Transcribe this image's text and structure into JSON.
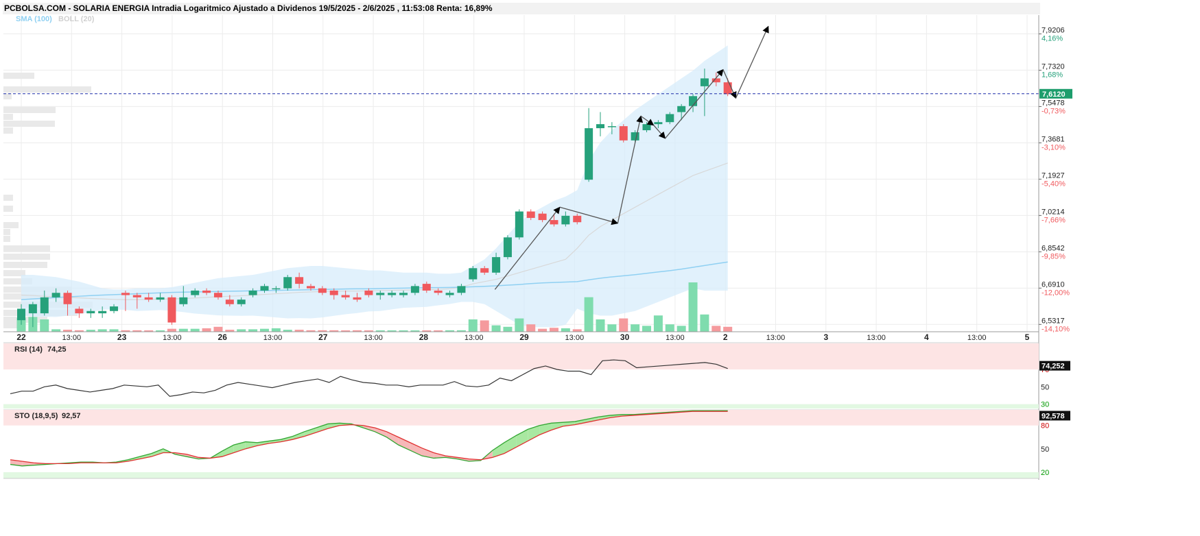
{
  "title": "PCBOLSA.COM - SOLARIA ENERGIA Intradia Logaritmico Ajustado a Dividenos 19/5/2025 - 2/6/2025 , 11:53:08 Renta: 16,89%",
  "indicators_label": {
    "sma": "SMA (100)",
    "boll": "BOLL (20)"
  },
  "colors": {
    "up": "#26a17b",
    "down": "#f0595d",
    "band": "#d7ecfb",
    "sma": "#8fd0f2",
    "mid": "#d8d8d8",
    "last_price": "#1d9d6c",
    "dashed": "#1a2aa8"
  },
  "last_price_label": "7,6120",
  "x_axis": {
    "ticks": [
      "22",
      "13:00",
      "23",
      "13:00",
      "26",
      "13:00",
      "27",
      "13:00",
      "28",
      "13:00",
      "29",
      "13:00",
      "30",
      "13:00",
      "2",
      "13:00",
      "3",
      "13:00",
      "4",
      "13:00",
      "5"
    ]
  },
  "y_axis": {
    "ticks": [
      {
        "price": "7,9206",
        "pct": "4,16%",
        "pct_color": "up"
      },
      {
        "price": "7,7320",
        "pct": "1,68%",
        "pct_color": "up"
      },
      {
        "price": "7,5478",
        "pct": "-0,73%",
        "pct_color": "down"
      },
      {
        "price": "7,3681",
        "pct": "-3,10%",
        "pct_color": "down"
      },
      {
        "price": "7,1927",
        "pct": "-5,40%",
        "pct_color": "down"
      },
      {
        "price": "7,0214",
        "pct": "-7,66%",
        "pct_color": "down"
      },
      {
        "price": "6,8542",
        "pct": "-9,85%",
        "pct_color": "down"
      },
      {
        "price": "6,6910",
        "pct": "-12,00%",
        "pct_color": "down"
      },
      {
        "price": "6,5317",
        "pct": "-14,10%",
        "pct_color": "down"
      }
    ]
  },
  "rsi": {
    "label": "RSI (14)",
    "value": "74,25",
    "badge": "74,252",
    "levels": [
      "70",
      "50",
      "30"
    ]
  },
  "sto": {
    "label": "STO (18,9,5)",
    "value": "92,57",
    "badge": "92,578",
    "levels": [
      "80",
      "50",
      "20"
    ]
  },
  "chart_data": {
    "type": "candlestick",
    "title": "PCBOLSA.COM - SOLARIA ENERGIA Intradia Logaritmico Ajustado a Dividenos 19/5/2025 - 2/6/2025 , 11:53:08 Renta: 16,89%",
    "y_scale": "log",
    "ylim": [
      6.5,
      8.02
    ],
    "last_price": 7.612,
    "candles": [
      {
        "o": 6.55,
        "h": 6.62,
        "l": 6.53,
        "c": 6.6
      },
      {
        "o": 6.58,
        "h": 6.63,
        "l": 6.52,
        "c": 6.62
      },
      {
        "o": 6.58,
        "h": 6.68,
        "l": 6.57,
        "c": 6.65
      },
      {
        "o": 6.65,
        "h": 6.69,
        "l": 6.63,
        "c": 6.67
      },
      {
        "o": 6.67,
        "h": 6.68,
        "l": 6.57,
        "c": 6.62
      },
      {
        "o": 6.6,
        "h": 6.61,
        "l": 6.56,
        "c": 6.58
      },
      {
        "o": 6.58,
        "h": 6.6,
        "l": 6.56,
        "c": 6.59
      },
      {
        "o": 6.58,
        "h": 6.61,
        "l": 6.56,
        "c": 6.59
      },
      {
        "o": 6.59,
        "h": 6.62,
        "l": 6.58,
        "c": 6.61
      },
      {
        "o": 6.67,
        "h": 6.68,
        "l": 6.59,
        "c": 6.66
      },
      {
        "o": 6.66,
        "h": 6.67,
        "l": 6.6,
        "c": 6.65
      },
      {
        "o": 6.65,
        "h": 6.67,
        "l": 6.63,
        "c": 6.64
      },
      {
        "o": 6.64,
        "h": 6.67,
        "l": 6.63,
        "c": 6.65
      },
      {
        "o": 6.65,
        "h": 6.66,
        "l": 6.53,
        "c": 6.54
      },
      {
        "o": 6.62,
        "h": 6.7,
        "l": 6.61,
        "c": 6.65
      },
      {
        "o": 6.66,
        "h": 6.69,
        "l": 6.65,
        "c": 6.68
      },
      {
        "o": 6.68,
        "h": 6.69,
        "l": 6.66,
        "c": 6.67
      },
      {
        "o": 6.67,
        "h": 6.68,
        "l": 6.64,
        "c": 6.65
      },
      {
        "o": 6.64,
        "h": 6.66,
        "l": 6.61,
        "c": 6.62
      },
      {
        "o": 6.62,
        "h": 6.65,
        "l": 6.61,
        "c": 6.64
      },
      {
        "o": 6.66,
        "h": 6.69,
        "l": 6.65,
        "c": 6.68
      },
      {
        "o": 6.68,
        "h": 6.71,
        "l": 6.67,
        "c": 6.7
      },
      {
        "o": 6.69,
        "h": 6.7,
        "l": 6.67,
        "c": 6.69
      },
      {
        "o": 6.69,
        "h": 6.75,
        "l": 6.68,
        "c": 6.74
      },
      {
        "o": 6.74,
        "h": 6.76,
        "l": 6.69,
        "c": 6.71
      },
      {
        "o": 6.7,
        "h": 6.71,
        "l": 6.68,
        "c": 6.69
      },
      {
        "o": 6.69,
        "h": 6.7,
        "l": 6.66,
        "c": 6.67
      },
      {
        "o": 6.68,
        "h": 6.69,
        "l": 6.64,
        "c": 6.66
      },
      {
        "o": 6.66,
        "h": 6.68,
        "l": 6.64,
        "c": 6.65
      },
      {
        "o": 6.65,
        "h": 6.67,
        "l": 6.63,
        "c": 6.64
      },
      {
        "o": 6.68,
        "h": 6.69,
        "l": 6.65,
        "c": 6.66
      },
      {
        "o": 6.66,
        "h": 6.68,
        "l": 6.64,
        "c": 6.67
      },
      {
        "o": 6.66,
        "h": 6.68,
        "l": 6.65,
        "c": 6.67
      },
      {
        "o": 6.66,
        "h": 6.68,
        "l": 6.65,
        "c": 6.67
      },
      {
        "o": 6.67,
        "h": 6.71,
        "l": 6.66,
        "c": 6.7
      },
      {
        "o": 6.71,
        "h": 6.72,
        "l": 6.67,
        "c": 6.68
      },
      {
        "o": 6.68,
        "h": 6.69,
        "l": 6.66,
        "c": 6.67
      },
      {
        "o": 6.66,
        "h": 6.68,
        "l": 6.65,
        "c": 6.67
      },
      {
        "o": 6.67,
        "h": 6.71,
        "l": 6.66,
        "c": 6.7
      },
      {
        "o": 6.73,
        "h": 6.79,
        "l": 6.72,
        "c": 6.78
      },
      {
        "o": 6.78,
        "h": 6.79,
        "l": 6.75,
        "c": 6.76
      },
      {
        "o": 6.76,
        "h": 6.85,
        "l": 6.75,
        "c": 6.83
      },
      {
        "o": 6.83,
        "h": 6.93,
        "l": 6.82,
        "c": 6.92
      },
      {
        "o": 6.92,
        "h": 7.05,
        "l": 6.91,
        "c": 7.04
      },
      {
        "o": 7.04,
        "h": 7.05,
        "l": 7.0,
        "c": 7.01
      },
      {
        "o": 7.03,
        "h": 7.04,
        "l": 6.99,
        "c": 7.0
      },
      {
        "o": 7.0,
        "h": 7.03,
        "l": 6.97,
        "c": 6.98
      },
      {
        "o": 6.98,
        "h": 7.04,
        "l": 6.97,
        "c": 7.02
      },
      {
        "o": 7.02,
        "h": 7.03,
        "l": 6.98,
        "c": 6.99
      },
      {
        "o": 7.19,
        "h": 7.54,
        "l": 7.18,
        "c": 7.44
      },
      {
        "o": 7.44,
        "h": 7.52,
        "l": 7.4,
        "c": 7.46
      },
      {
        "o": 7.45,
        "h": 7.47,
        "l": 7.41,
        "c": 7.45
      },
      {
        "o": 7.45,
        "h": 7.46,
        "l": 7.37,
        "c": 7.38
      },
      {
        "o": 7.38,
        "h": 7.43,
        "l": 7.37,
        "c": 7.42
      },
      {
        "o": 7.43,
        "h": 7.47,
        "l": 7.42,
        "c": 7.46
      },
      {
        "o": 7.46,
        "h": 7.48,
        "l": 7.44,
        "c": 7.47
      },
      {
        "o": 7.47,
        "h": 7.52,
        "l": 7.46,
        "c": 7.51
      },
      {
        "o": 7.52,
        "h": 7.56,
        "l": 7.48,
        "c": 7.55
      },
      {
        "o": 7.55,
        "h": 7.61,
        "l": 7.52,
        "c": 7.6
      },
      {
        "o": 7.65,
        "h": 7.74,
        "l": 7.5,
        "c": 7.69
      },
      {
        "o": 7.69,
        "h": 7.72,
        "l": 7.65,
        "c": 7.67
      },
      {
        "o": 7.67,
        "h": 7.69,
        "l": 7.6,
        "c": 7.61
      }
    ],
    "volume_relative": [
      0.28,
      0.3,
      0.25,
      0.05,
      0.04,
      0.03,
      0.04,
      0.05,
      0.05,
      0.03,
      0.03,
      0.02,
      0.02,
      0.06,
      0.06,
      0.06,
      0.07,
      0.1,
      0.04,
      0.05,
      0.05,
      0.06,
      0.07,
      0.04,
      0.04,
      0.03,
      0.03,
      0.03,
      0.02,
      0.03,
      0.02,
      0.02,
      0.02,
      0.02,
      0.02,
      0.02,
      0.02,
      0.03,
      0.03,
      0.25,
      0.23,
      0.13,
      0.1,
      0.27,
      0.15,
      0.06,
      0.08,
      0.07,
      0.05,
      0.7,
      0.25,
      0.15,
      0.27,
      0.15,
      0.12,
      0.33,
      0.15,
      0.12,
      1.0,
      0.35,
      0.12,
      0.1
    ],
    "sma100": [
      6.64,
      6.643,
      6.646,
      6.649,
      6.652,
      6.655,
      6.658,
      6.66,
      6.662,
      6.664,
      6.666,
      6.668,
      6.67,
      6.672,
      6.673,
      6.674,
      6.675,
      6.676,
      6.677,
      6.678,
      6.679,
      6.68,
      6.681,
      6.682,
      6.683,
      6.684,
      6.685,
      6.686,
      6.687,
      6.688,
      6.688,
      6.689,
      6.69,
      6.691,
      6.692,
      6.693,
      6.693,
      6.694,
      6.695,
      6.697,
      6.699,
      6.701,
      6.704,
      6.707,
      6.711,
      6.714,
      6.716,
      6.718,
      6.72,
      6.728,
      6.735,
      6.741,
      6.746,
      6.751,
      6.757,
      6.763,
      6.769,
      6.776,
      6.784,
      6.792,
      6.8,
      6.808
    ],
    "bollinger_upper": [
      6.75,
      6.75,
      6.745,
      6.74,
      6.73,
      6.72,
      6.705,
      6.69,
      6.685,
      6.685,
      6.69,
      6.69,
      6.69,
      6.695,
      6.705,
      6.715,
      6.725,
      6.735,
      6.74,
      6.745,
      6.75,
      6.76,
      6.77,
      6.78,
      6.785,
      6.79,
      6.79,
      6.785,
      6.78,
      6.775,
      6.77,
      6.77,
      6.765,
      6.76,
      6.76,
      6.76,
      6.755,
      6.755,
      6.76,
      6.79,
      6.82,
      6.87,
      6.93,
      6.99,
      7.03,
      7.06,
      7.09,
      7.11,
      7.14,
      7.28,
      7.37,
      7.43,
      7.48,
      7.53,
      7.57,
      7.61,
      7.65,
      7.69,
      7.73,
      7.78,
      7.82,
      7.86
    ],
    "bollinger_mid": [
      6.66,
      6.658,
      6.655,
      6.652,
      6.65,
      6.648,
      6.645,
      6.643,
      6.641,
      6.64,
      6.64,
      6.641,
      6.642,
      6.643,
      6.645,
      6.647,
      6.65,
      6.653,
      6.655,
      6.657,
      6.66,
      6.663,
      6.666,
      6.669,
      6.672,
      6.674,
      6.676,
      6.677,
      6.678,
      6.678,
      6.679,
      6.68,
      6.681,
      6.682,
      6.683,
      6.684,
      6.685,
      6.688,
      6.695,
      6.71,
      6.72,
      6.73,
      6.745,
      6.76,
      6.775,
      6.79,
      6.805,
      6.82,
      6.87,
      6.93,
      6.97,
      7.0,
      7.03,
      7.06,
      7.09,
      7.12,
      7.15,
      7.18,
      7.21,
      7.23,
      7.25,
      7.27
    ],
    "bollinger_lower": [
      6.57,
      6.566,
      6.565,
      6.564,
      6.57,
      6.576,
      6.585,
      6.596,
      6.597,
      6.595,
      6.59,
      6.592,
      6.594,
      6.591,
      6.585,
      6.579,
      6.575,
      6.571,
      6.57,
      6.569,
      6.57,
      6.566,
      6.562,
      6.558,
      6.559,
      6.558,
      6.562,
      6.569,
      6.576,
      6.581,
      6.588,
      6.59,
      6.597,
      6.604,
      6.606,
      6.608,
      6.615,
      6.621,
      6.63,
      6.63,
      6.62,
      6.59,
      6.56,
      6.53,
      6.52,
      6.52,
      6.52,
      6.53,
      6.6,
      6.58,
      6.57,
      6.57,
      6.58,
      6.59,
      6.61,
      6.63,
      6.65,
      6.67,
      6.69,
      6.68,
      6.68,
      6.68
    ],
    "rsi_values": [
      42,
      45,
      45,
      50,
      52,
      48,
      46,
      44,
      46,
      48,
      52,
      51,
      50,
      52,
      39,
      41,
      44,
      43,
      46,
      52,
      55,
      53,
      51,
      49,
      52,
      55,
      57,
      59,
      55,
      62,
      58,
      55,
      54,
      52,
      52,
      50,
      52,
      52,
      52,
      56,
      51,
      50,
      52,
      60,
      57,
      64,
      71,
      74,
      70,
      68,
      68,
      64,
      80,
      81,
      80,
      72,
      73,
      74,
      75,
      76,
      77,
      78,
      76,
      71
    ],
    "sto_k": [
      30,
      28,
      29,
      30,
      31,
      32,
      33,
      33,
      32,
      33,
      36,
      40,
      44,
      50,
      43,
      40,
      37,
      38,
      47,
      55,
      59,
      58,
      60,
      62,
      66,
      72,
      77,
      82,
      83,
      82,
      77,
      72,
      65,
      55,
      48,
      41,
      38,
      39,
      37,
      34,
      35,
      48,
      58,
      67,
      75,
      80,
      83,
      84,
      85,
      88,
      91,
      93,
      94,
      94,
      95,
      96,
      97,
      98,
      99,
      99,
      99,
      99
    ],
    "sto_d": [
      36,
      34,
      32,
      31,
      31,
      31,
      32,
      32,
      32,
      32,
      34,
      37,
      40,
      45,
      45,
      43,
      39,
      38,
      40,
      45,
      50,
      54,
      57,
      59,
      62,
      66,
      71,
      76,
      80,
      81,
      80,
      77,
      72,
      65,
      58,
      51,
      45,
      41,
      39,
      37,
      36,
      39,
      44,
      52,
      60,
      68,
      74,
      79,
      81,
      84,
      87,
      90,
      92,
      93,
      94,
      95,
      96,
      97,
      98,
      98,
      98,
      98
    ]
  }
}
